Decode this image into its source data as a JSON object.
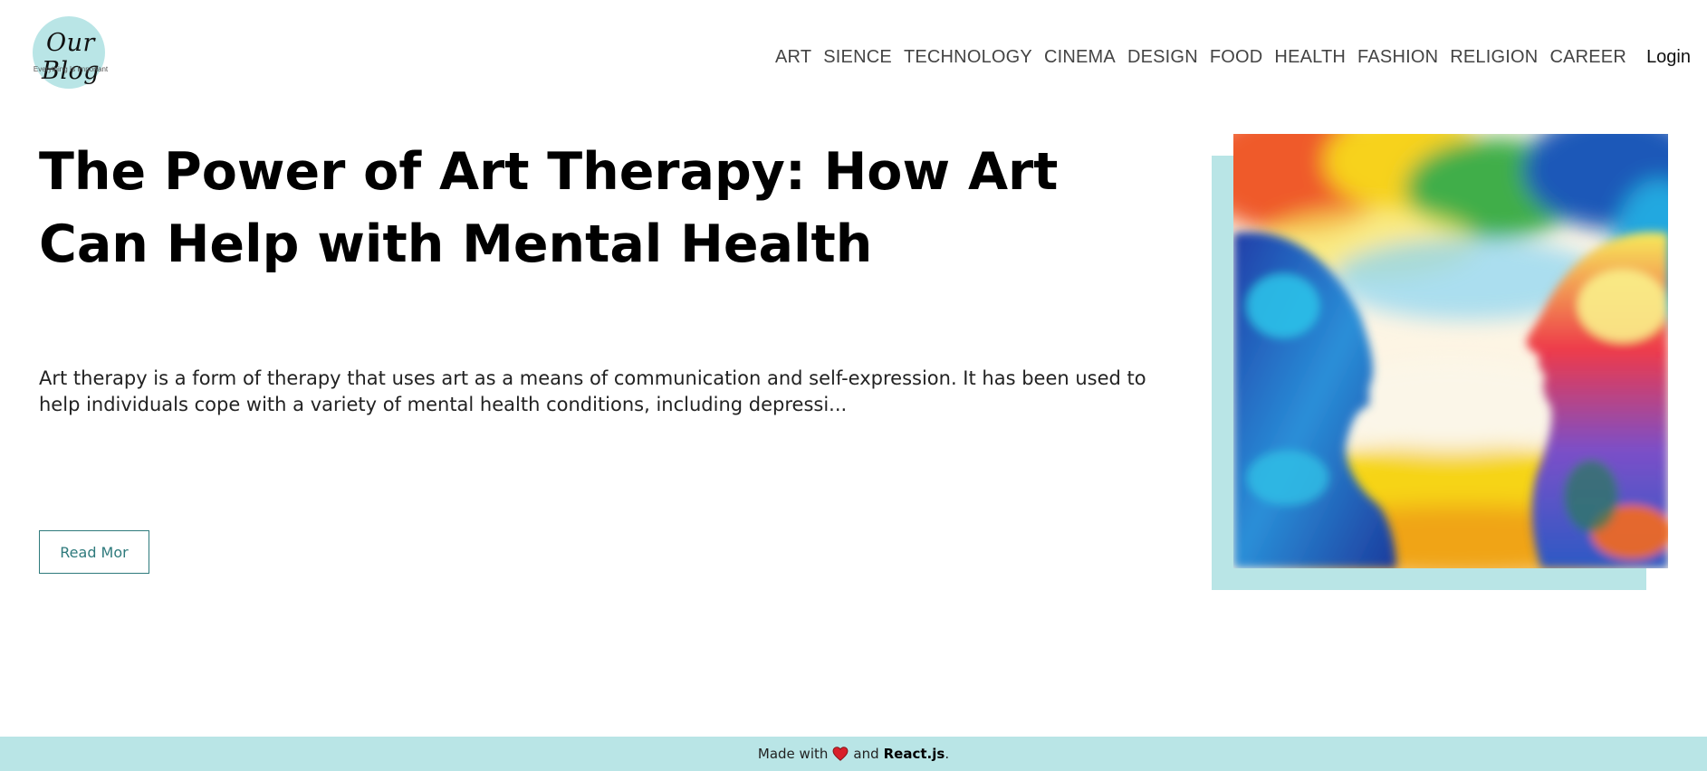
{
  "brand": {
    "title": "Our Blog",
    "tagline": "Everything Is Important"
  },
  "nav": {
    "links": [
      "ART",
      "SIENCE",
      "TECHNOLOGY",
      "CINEMA",
      "DESIGN",
      "FOOD",
      "HEALTH",
      "FASHION",
      "RELIGION",
      "CAREER"
    ],
    "login_label": "Login"
  },
  "post": {
    "title": "The Power of Art Therapy: How Art Can Help with Mental Health",
    "description": "Art therapy is a form of therapy that uses art as a means of communication and self-expression. It has been used to help individuals cope with a variety of mental health conditions, including depressi...",
    "read_more_label": "Read Mor"
  },
  "footer": {
    "prefix": "Made with",
    "middle": "and",
    "tech": "React.js",
    "suffix": "."
  },
  "colors": {
    "accent": "#b9e5e6",
    "button": "#2e7a7c"
  },
  "icons": {
    "heart": "heart-icon"
  }
}
